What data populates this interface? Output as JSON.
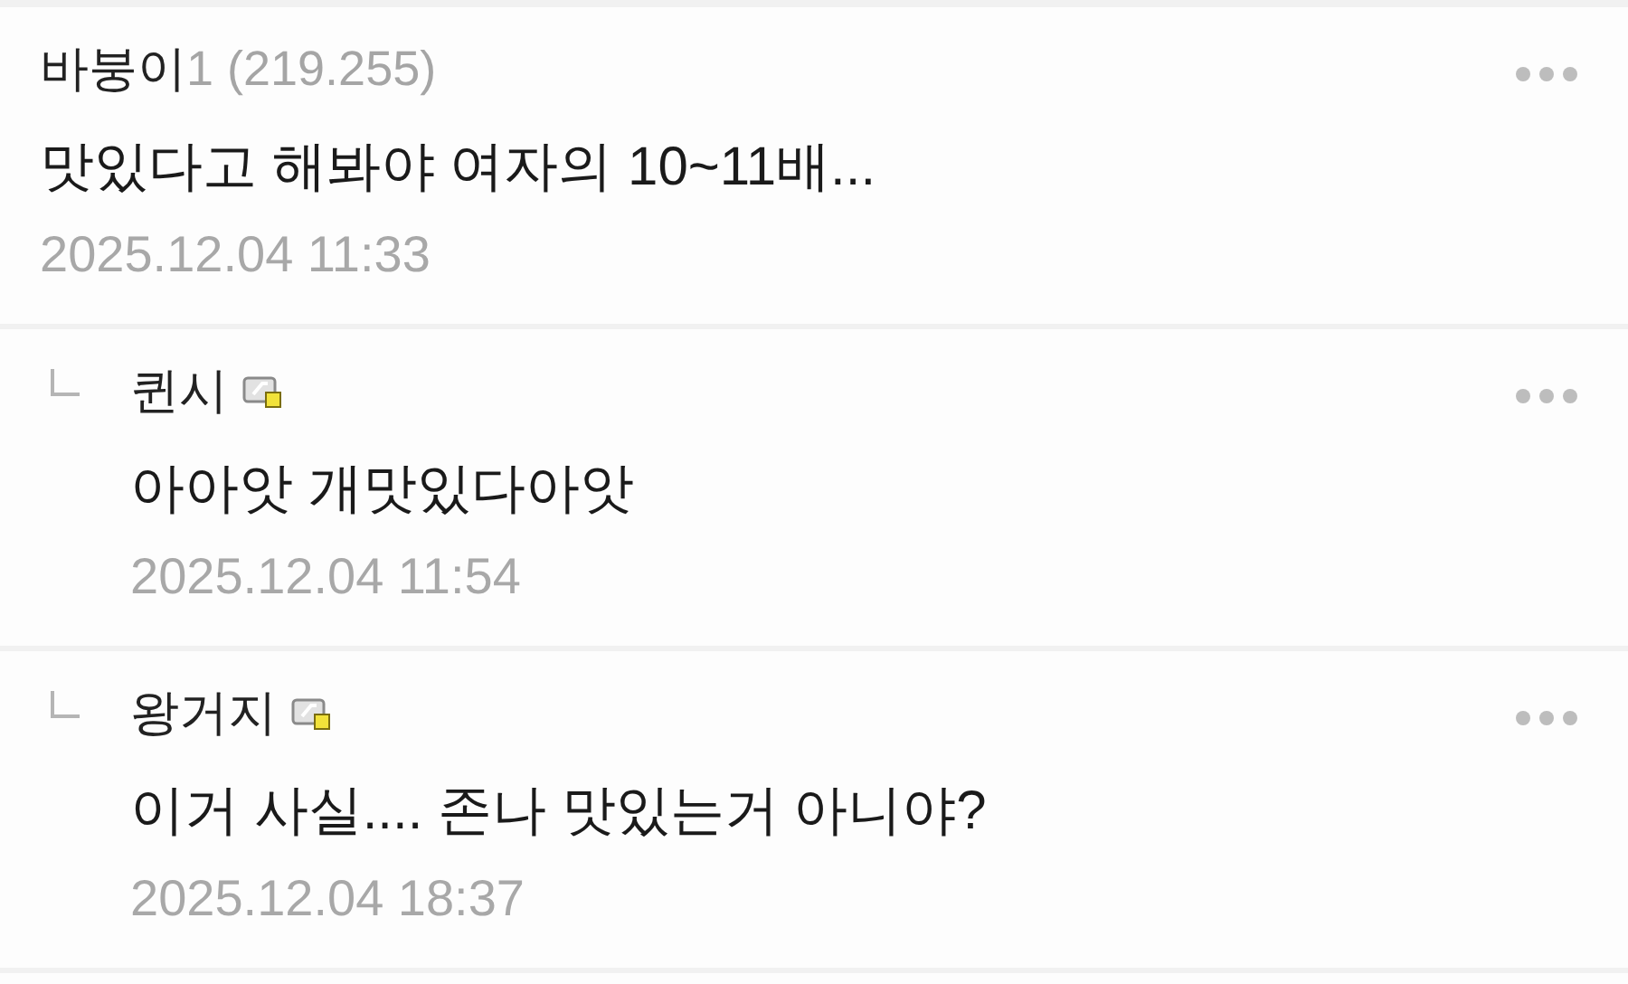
{
  "comments": [
    {
      "kind": "comment",
      "author": "바붕이",
      "author_suffix": "1 (219.255)",
      "member_icon": false,
      "text": "맛있다고 해봐야 여자의 10~11배...",
      "date": "2025.12.04 11:33"
    },
    {
      "kind": "reply",
      "author": "퀸시",
      "member_icon": true,
      "text": "아아앗 개맛있다아앗",
      "date": "2025.12.04 11:54"
    },
    {
      "kind": "reply",
      "author": "왕거지",
      "member_icon": true,
      "text": "이거 사실.... 존나 맛있는거 아니야?",
      "date": "2025.12.04 18:37"
    }
  ]
}
